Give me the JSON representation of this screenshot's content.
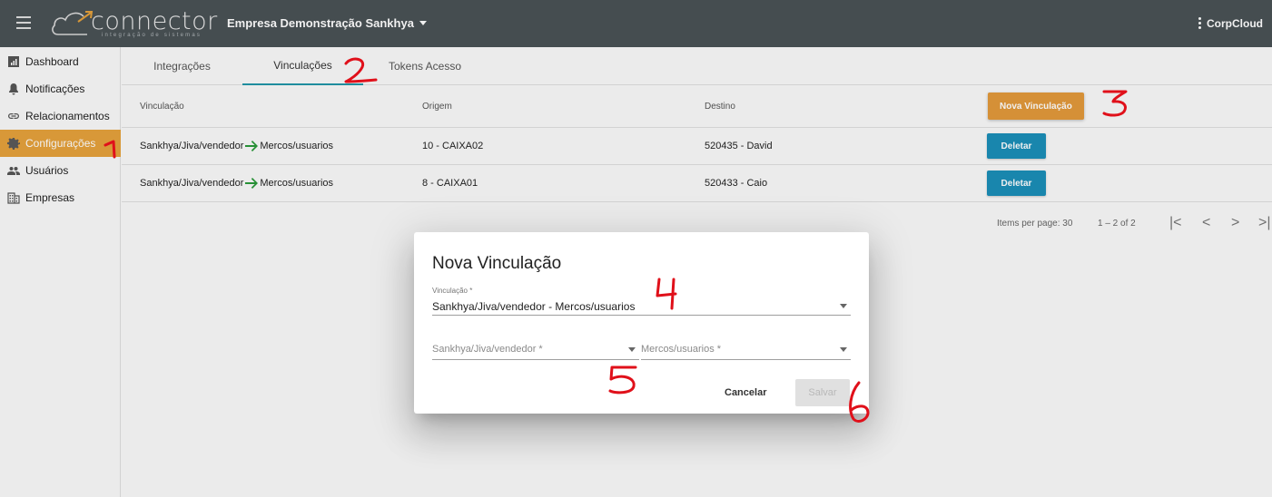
{
  "header": {
    "logo_word": "connector",
    "logo_tagline": "integração de sistemas",
    "company": "Empresa Demonstração Sankhya",
    "user": "CorpCloud"
  },
  "sidebar": {
    "items": [
      {
        "label": "Dashboard",
        "icon": "dashboard-icon"
      },
      {
        "label": "Notificações",
        "icon": "bell-icon"
      },
      {
        "label": "Relacionamentos",
        "icon": "link-icon"
      },
      {
        "label": "Configurações",
        "icon": "gear-icon",
        "active": true
      },
      {
        "label": "Usuários",
        "icon": "users-icon"
      },
      {
        "label": "Empresas",
        "icon": "building-icon"
      }
    ]
  },
  "tabs": [
    {
      "label": "Integrações"
    },
    {
      "label": "Vinculações",
      "active": true
    },
    {
      "label": "Tokens Acesso"
    }
  ],
  "table": {
    "headers": {
      "vinculacao": "Vinculação",
      "origem": "Origem",
      "destino": "Destino"
    },
    "new_button": "Nova Vinculação",
    "rows": [
      {
        "from": "Sankhya/Jiva/vendedor",
        "to": "Mercos/usuarios",
        "origem": "10 - CAIXA02",
        "destino": "520435 - David",
        "action": "Deletar"
      },
      {
        "from": "Sankhya/Jiva/vendedor",
        "to": "Mercos/usuarios",
        "origem": "8 - CAIXA01",
        "destino": "520433 - Caio",
        "action": "Deletar"
      }
    ]
  },
  "paginator": {
    "items_per_page_label": "Items per page: 30",
    "range": "1 – 2 of 2",
    "first": "|<",
    "prev": "<",
    "next": ">",
    "last": ">|"
  },
  "dialog": {
    "title": "Nova Vinculação",
    "vinculacao_label": "Vinculação *",
    "vinculacao_value": "Sankhya/Jiva/vendedor - Mercos/usuarios",
    "origin_placeholder": "Sankhya/Jiva/vendedor *",
    "dest_placeholder": "Mercos/usuarios *",
    "cancel": "Cancelar",
    "save": "Salvar"
  },
  "annotations": [
    "1",
    "2",
    "3",
    "4",
    "5",
    "6"
  ],
  "colors": {
    "topbar": "#4a5256",
    "accent_orange": "#e39a3b",
    "accent_blue": "#1b8fb8",
    "annotation_red": "#e0101a"
  }
}
